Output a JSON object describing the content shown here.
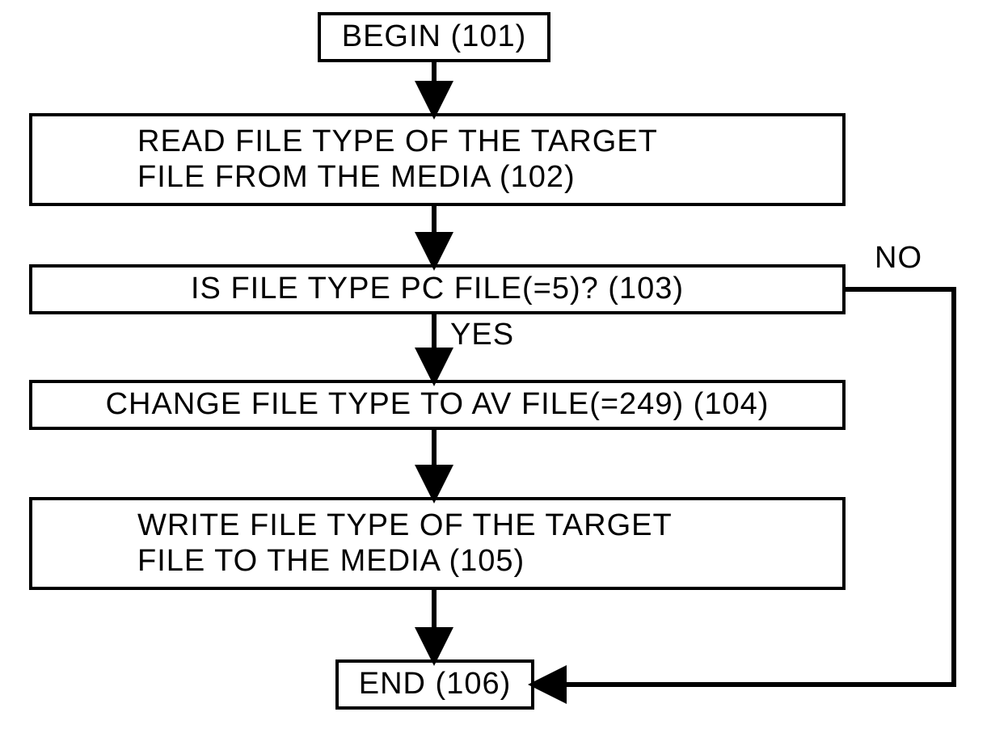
{
  "flowchart": {
    "nodes": {
      "begin": {
        "id": 101,
        "text": "BEGIN (101)"
      },
      "read": {
        "id": 102,
        "text": "READ FILE TYPE OF THE TARGET\nFILE FROM THE MEDIA (102)"
      },
      "check": {
        "id": 103,
        "text": "IS FILE TYPE PC FILE(=5)? (103)"
      },
      "change": {
        "id": 104,
        "text": "CHANGE FILE TYPE TO AV FILE(=249) (104)"
      },
      "write": {
        "id": 105,
        "text": "WRITE FILE TYPE OF THE TARGET\nFILE TO THE MEDIA (105)"
      },
      "end": {
        "id": 106,
        "text": "END (106)"
      }
    },
    "branches": {
      "yes": "YES",
      "no": "NO"
    },
    "edges": [
      {
        "from": "begin",
        "to": "read"
      },
      {
        "from": "read",
        "to": "check"
      },
      {
        "from": "check",
        "to": "change",
        "label": "yes"
      },
      {
        "from": "check",
        "to": "end",
        "label": "no"
      },
      {
        "from": "change",
        "to": "write"
      },
      {
        "from": "write",
        "to": "end"
      }
    ]
  }
}
